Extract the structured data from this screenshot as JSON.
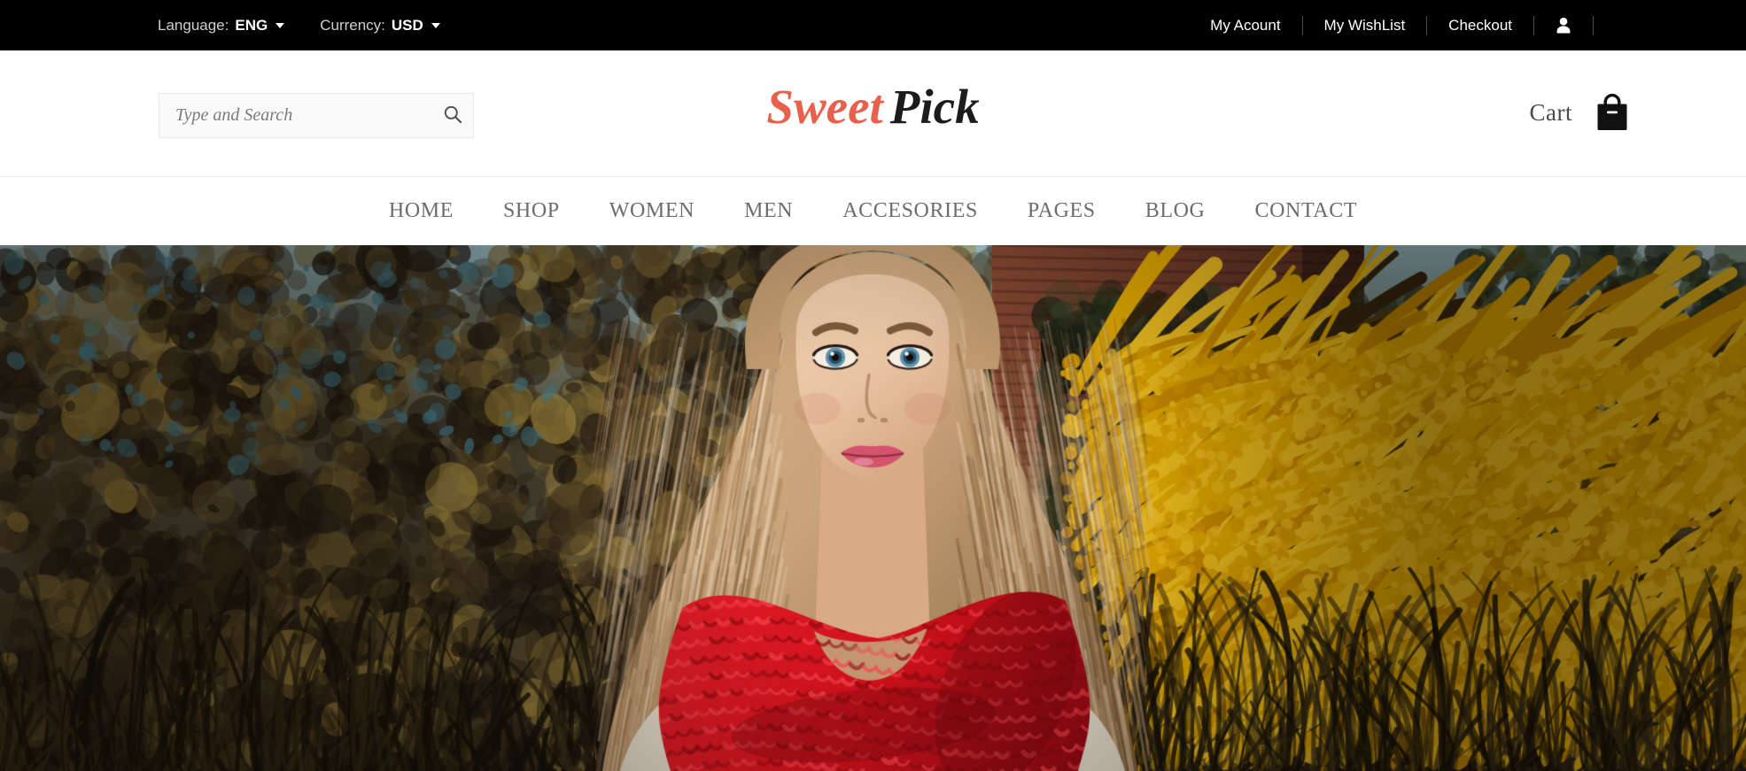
{
  "topbar": {
    "language": {
      "label": "Language:",
      "value": "ENG"
    },
    "currency": {
      "label": "Currency:",
      "value": "USD"
    },
    "links": [
      {
        "label": "My Acount"
      },
      {
        "label": "My WishList"
      },
      {
        "label": "Checkout"
      }
    ],
    "account_icon": "user-icon"
  },
  "header": {
    "search": {
      "placeholder": "Type and Search",
      "value": "",
      "icon": "search-icon"
    },
    "logo": {
      "part1": "Sweet",
      "part2": "Pick",
      "part1_color": "#e8604c",
      "part2_color": "#1c1c1c"
    },
    "cart": {
      "label": "Cart",
      "icon": "shopping-bag-icon"
    }
  },
  "nav": {
    "items": [
      {
        "label": "HOME"
      },
      {
        "label": "SHOP"
      },
      {
        "label": "WOMEN"
      },
      {
        "label": "MEN"
      },
      {
        "label": "ACCESORIES"
      },
      {
        "label": "PAGES"
      },
      {
        "label": "BLOG"
      },
      {
        "label": "CONTACT"
      }
    ]
  },
  "hero": {
    "description": "Blonde woman wearing a red knitted scarf standing outdoors in front of autumn foliage, a rustic wooden barn and bright yellow goldenrod flowers",
    "colors": {
      "sky": "#a8d2de",
      "foliage_dark": "#2b2117",
      "goldenrod": "#f0b400",
      "barn": "#6d3a2c",
      "scarf": "#d0111b",
      "hair": "#c9a37a",
      "skin": "#e9c4a4",
      "coat": "#e6dccb"
    }
  }
}
